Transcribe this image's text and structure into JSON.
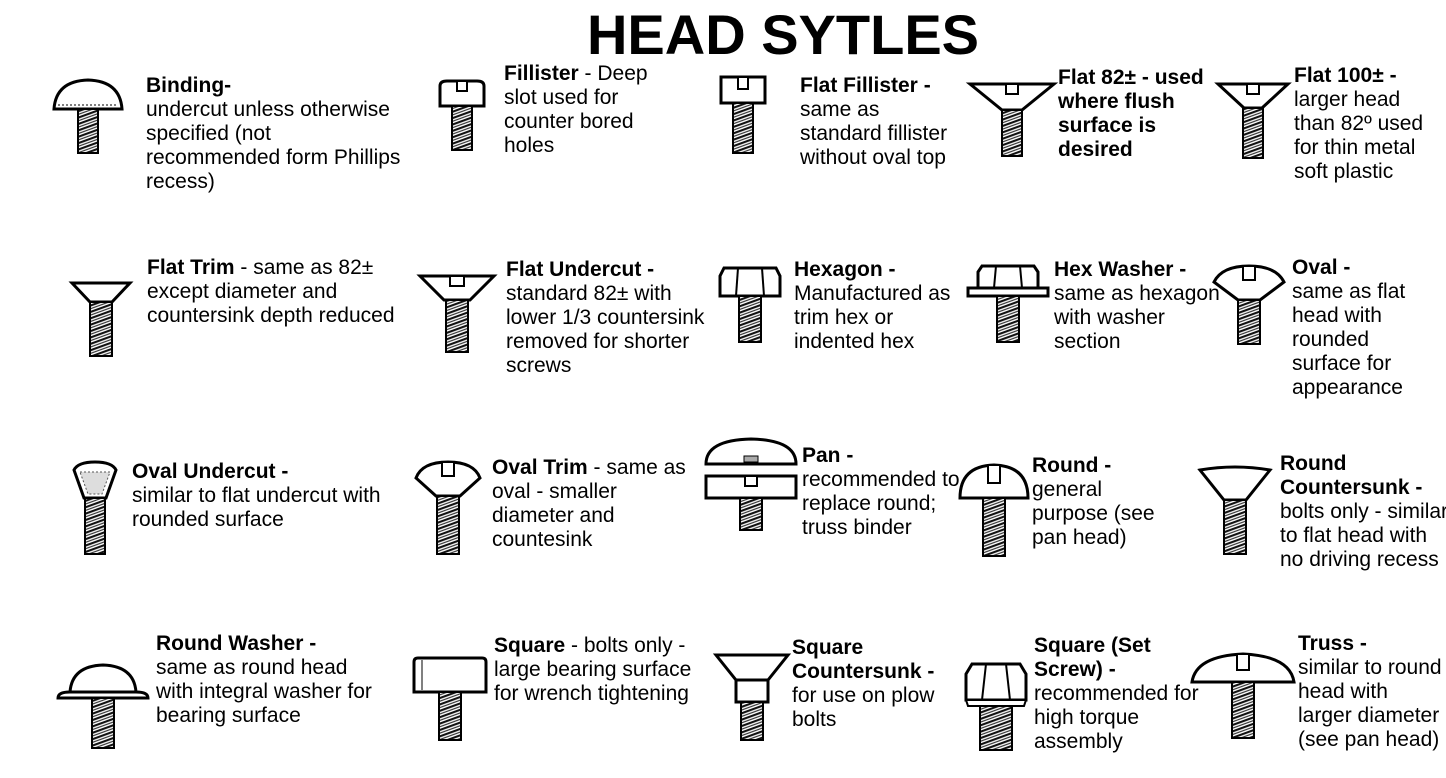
{
  "title": "HEAD SYTLES",
  "styles": [
    {
      "name": "Binding-",
      "text": "undercut unless otherwise specified (not recommended form Phillips recess)",
      "icon": "binding-head-screw-icon"
    },
    {
      "name": "Fillister",
      "dash": " - ",
      "text": "Deep slot used for counter bored holes",
      "icon": "fillister-head-screw-icon"
    },
    {
      "name": "Flat Fillister -",
      "text": "same as standard fillister without oval top",
      "icon": "flat-fillister-head-screw-icon"
    },
    {
      "name": "Flat 82± - used where flush surface is desired",
      "text": "",
      "icon": "flat-82-head-screw-icon"
    },
    {
      "name": "Flat 100± -",
      "text": "larger head than 82º used for thin metal soft plastic",
      "icon": "flat-100-head-screw-icon"
    },
    {
      "name": "Flat Trim",
      "dash": " - ",
      "text": "same as 82± except diameter and countersink depth reduced",
      "icon": "flat-trim-head-screw-icon"
    },
    {
      "name": "Flat Undercut -",
      "text": "standard 82± with lower 1/3 countersink removed for shorter screws",
      "icon": "flat-undercut-head-screw-icon"
    },
    {
      "name": "Hexagon -",
      "text": "Manufactured as trim hex or indented hex",
      "icon": "hexagon-head-screw-icon"
    },
    {
      "name": "Hex Washer -",
      "text": "same as hexagon with washer section",
      "icon": "hex-washer-head-screw-icon"
    },
    {
      "name": "Oval -",
      "text": "same as flat head with rounded surface for appearance",
      "icon": "oval-head-screw-icon"
    },
    {
      "name": "Oval Undercut -",
      "text": "similar to flat undercut with rounded surface",
      "icon": "oval-undercut-head-screw-icon"
    },
    {
      "name": "Oval Trim",
      "dash": " - ",
      "text": "same as oval - smaller diameter and countesink",
      "icon": "oval-trim-head-screw-icon"
    },
    {
      "name": "Pan -",
      "text": "recommended to replace round; truss binder",
      "icon": "pan-head-screw-icon"
    },
    {
      "name": "Round -",
      "text": "general purpose (see pan head)",
      "icon": "round-head-screw-icon"
    },
    {
      "name": "Round Countersunk -",
      "text": "bolts only - similar to flat head with no driving recess",
      "icon": "round-countersunk-head-bolt-icon"
    },
    {
      "name": "Round Washer -",
      "text": "same as round head with integral washer for bearing surface",
      "icon": "round-washer-head-screw-icon"
    },
    {
      "name": "Square",
      "dash": " - ",
      "text": "bolts only - large bearing surface for wrench tightening",
      "icon": "square-head-bolt-icon"
    },
    {
      "name": "Square Countersunk -",
      "text": "for use on plow bolts",
      "icon": "square-countersunk-head-bolt-icon"
    },
    {
      "name": "Square (Set Screw) -",
      "text": "recommended for high torque assembly",
      "icon": "square-set-screw-head-icon"
    },
    {
      "name": "Truss -",
      "text": "similar to round head with larger diameter (see pan head)",
      "icon": "truss-head-screw-icon"
    }
  ]
}
